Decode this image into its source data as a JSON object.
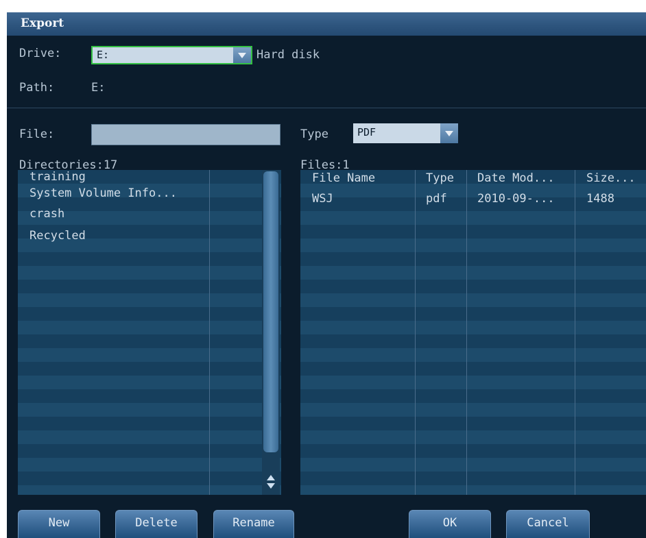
{
  "window": {
    "title": "Export"
  },
  "drive": {
    "label": "Drive:",
    "value": "E:",
    "description": "Hard disk"
  },
  "path": {
    "label": "Path:",
    "value": "E:"
  },
  "file": {
    "label": "File:",
    "value": ""
  },
  "type": {
    "label": "Type",
    "value": "PDF"
  },
  "directories": {
    "count_label": "Directories:17",
    "items": [
      "training",
      "System Volume Info...",
      "crash",
      "Recycled"
    ]
  },
  "files": {
    "count_label": "Files:1",
    "columns": [
      "File Name",
      "Type",
      "Date Mod...",
      "Size..."
    ],
    "rows": [
      {
        "name": "WSJ",
        "type": "pdf",
        "date": "2010-09-...",
        "size": "1488"
      }
    ]
  },
  "buttons": {
    "new": "New",
    "delete": "Delete",
    "rename": "Rename",
    "ok": "OK",
    "cancel": "Cancel"
  },
  "colors": {
    "background": "#0b1c2c",
    "title_bar": "#2e557e",
    "row_dark": "#163f5d",
    "row_light": "#1d4b6b",
    "focus_border": "#34c043"
  }
}
